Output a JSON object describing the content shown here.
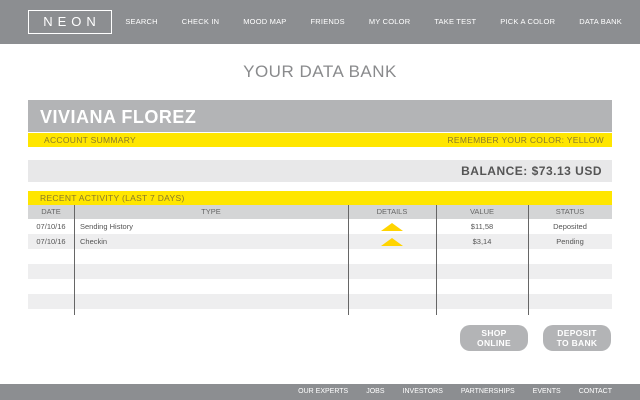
{
  "header": {
    "logo": "NEON",
    "nav": [
      "SEARCH",
      "CHECK IN",
      "MOOD MAP",
      "FRIENDS",
      "MY COLOR",
      "TAKE TEST",
      "PICK A COLOR",
      "DATA BANK"
    ]
  },
  "page_title": "YOUR DATA BANK",
  "account": {
    "name": "VIVIANA FLOREZ",
    "summary_label": "ACCOUNT SUMMARY",
    "color_note": "REMEMBER YOUR COLOR: YELLOW",
    "balance": "BALANCE: $73.13 USD"
  },
  "activity": {
    "title": "RECENT ACTIVITY (LAST 7 DAYS)",
    "columns": [
      "DATE",
      "TYPE",
      "DETAILS",
      "VALUE",
      "STATUS"
    ],
    "rows": [
      {
        "date": "07/10/16",
        "type": "Sending History",
        "value": "$11,58",
        "status": "Deposited"
      },
      {
        "date": "07/10/16",
        "type": "Checkin",
        "value": "$3,14",
        "status": "Pending"
      }
    ]
  },
  "buttons": {
    "shop_line1": "SHOP",
    "shop_line2": "ONLINE",
    "deposit_line1": "DEPOSIT",
    "deposit_line2": "TO BANK"
  },
  "footer": {
    "links": [
      "OUR EXPERTS",
      "JOBS",
      "INVESTORS",
      "PARTNERSHIPS",
      "EVENTS",
      "CONTACT"
    ]
  },
  "colors": {
    "accent": "#ffe600",
    "bar_gray": "#8c8e91",
    "panel_gray": "#b3b4b6"
  }
}
